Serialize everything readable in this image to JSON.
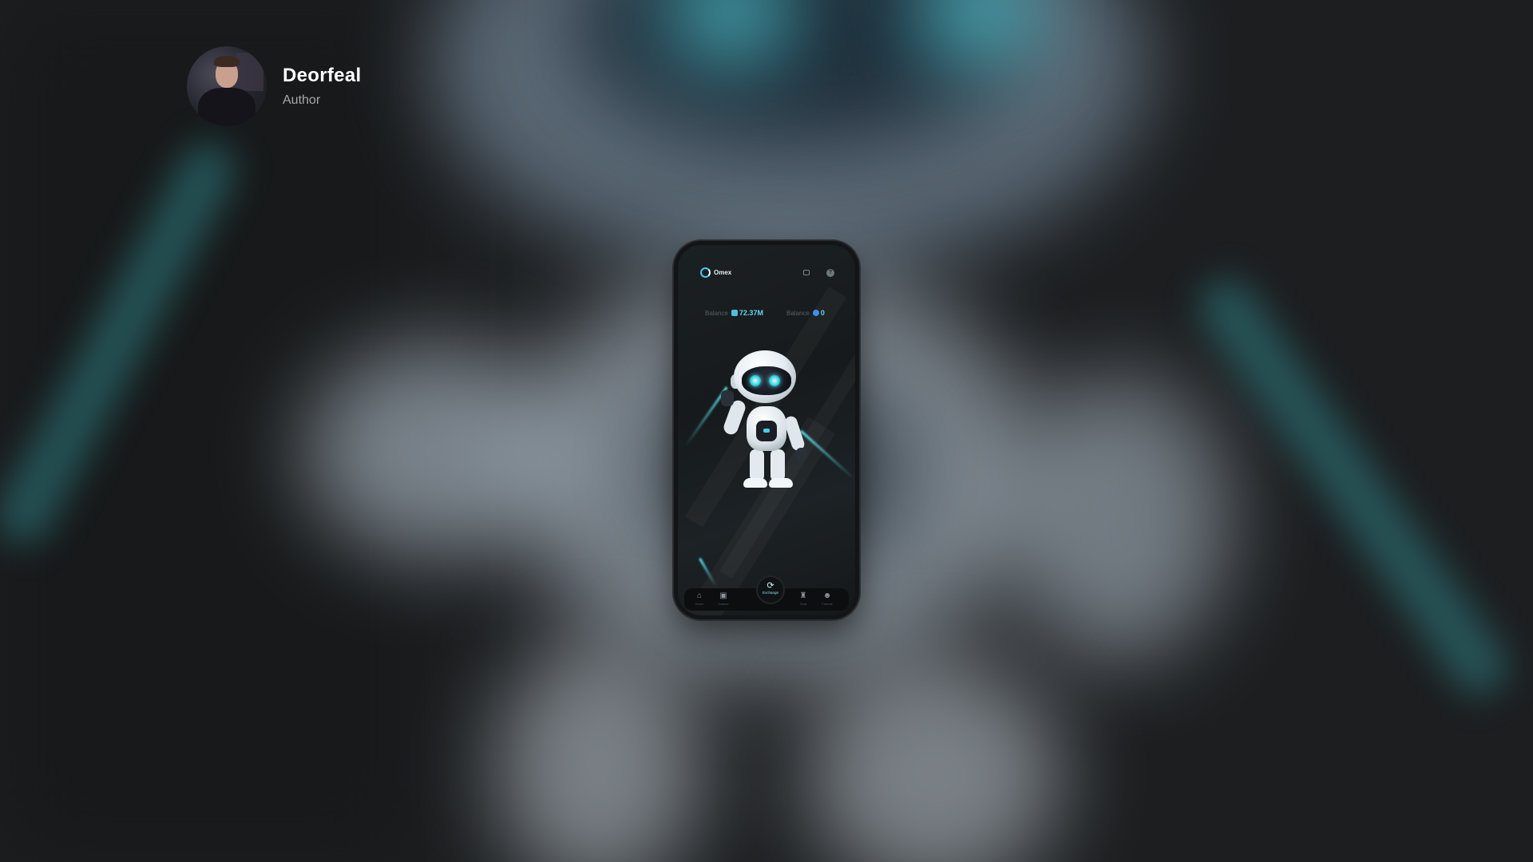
{
  "author": {
    "name": "Deorfeal",
    "role": "Author"
  },
  "app": {
    "name": "Omex",
    "top_icons": [
      "wallet-icon",
      "help-icon"
    ],
    "help_glyph": "?"
  },
  "balances": [
    {
      "label": "Balance",
      "icon": "token-icon",
      "value": "72.37M"
    },
    {
      "label": "Balance",
      "icon": "coin-icon",
      "value": "0"
    }
  ],
  "nav": {
    "home": {
      "label": "Home",
      "icon": "home-icon",
      "glyph": "⌂"
    },
    "games": {
      "label": "Games",
      "icon": "games-icon",
      "glyph": "▣"
    },
    "exchange": {
      "label": "Exchange",
      "icon": "exchange-icon",
      "glyph": "⟳"
    },
    "tools": {
      "label": "Tools",
      "icon": "tools-icon",
      "glyph": "♜"
    },
    "friends": {
      "label": "Friends",
      "icon": "friends-icon",
      "glyph": "☻"
    }
  },
  "colors": {
    "accent": "#63d4ec",
    "background": "#1c1e20",
    "author_name": "#ffffff",
    "author_role": "#a7a9ab"
  }
}
